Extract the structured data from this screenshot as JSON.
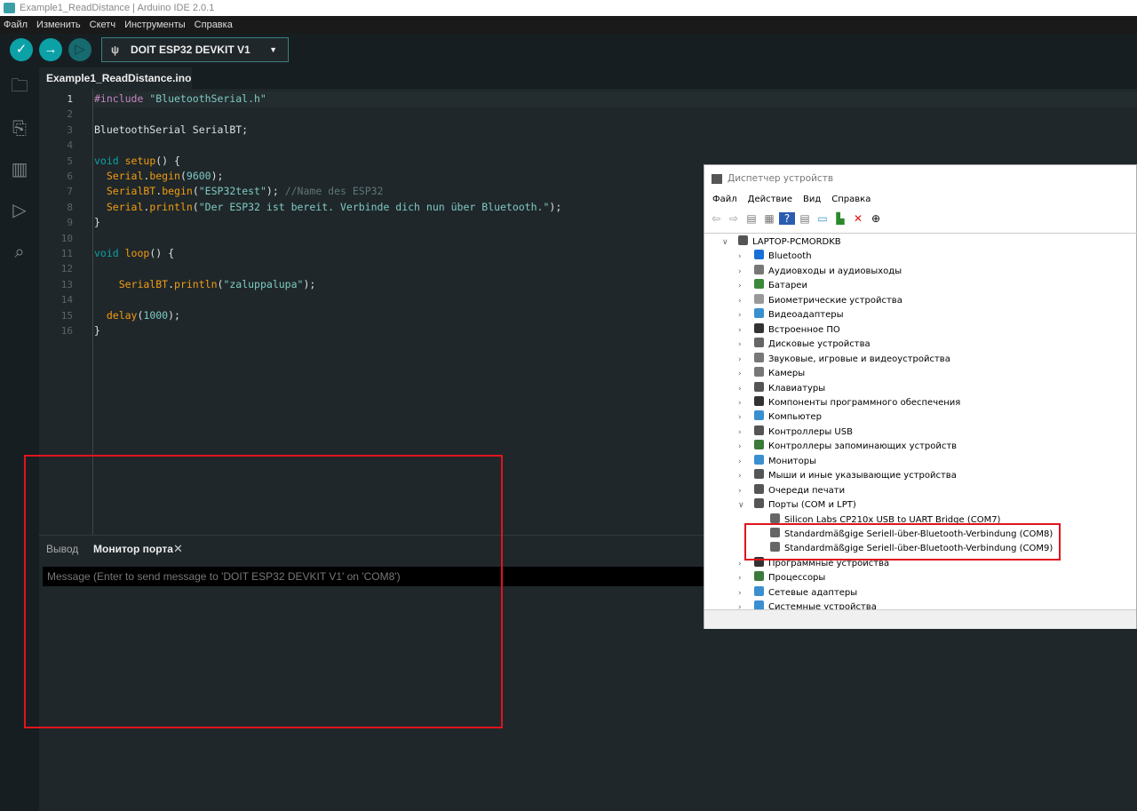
{
  "window": {
    "title": "Example1_ReadDistance | Arduino IDE 2.0.1"
  },
  "menu": [
    "Файл",
    "Изменить",
    "Скетч",
    "Инструменты",
    "Справка"
  ],
  "toolbar": {
    "verify_icon": "check-icon",
    "upload_icon": "arrow-right-icon",
    "debug_icon": "debug-icon",
    "board": "DOIT ESP32 DEVKIT V1"
  },
  "colors": {
    "accent": "#0ca1a6",
    "highlight_box": "#e0141e"
  },
  "editor": {
    "tab": "Example1_ReadDistance.ino",
    "lines": [
      [
        {
          "t": "#include ",
          "c": "k"
        },
        {
          "t": "\"BluetoothSerial.h\"",
          "c": "s"
        }
      ],
      [],
      [
        {
          "t": "BluetoothSerial SerialBT;",
          "c": "p"
        }
      ],
      [],
      [
        {
          "t": "void ",
          "c": "v"
        },
        {
          "t": "setup",
          "c": "f"
        },
        {
          "t": "() {",
          "c": "p"
        }
      ],
      [
        {
          "t": "  Serial",
          "c": "f"
        },
        {
          "t": ".",
          "c": "p"
        },
        {
          "t": "begin",
          "c": "f"
        },
        {
          "t": "(",
          "c": "p"
        },
        {
          "t": "9600",
          "c": "n"
        },
        {
          "t": ");",
          "c": "p"
        }
      ],
      [
        {
          "t": "  SerialBT",
          "c": "f"
        },
        {
          "t": ".",
          "c": "p"
        },
        {
          "t": "begin",
          "c": "f"
        },
        {
          "t": "(",
          "c": "p"
        },
        {
          "t": "\"ESP32test\"",
          "c": "s"
        },
        {
          "t": "); ",
          "c": "p"
        },
        {
          "t": "//Name des ESP32",
          "c": "c"
        }
      ],
      [
        {
          "t": "  Serial",
          "c": "f"
        },
        {
          "t": ".",
          "c": "p"
        },
        {
          "t": "println",
          "c": "f"
        },
        {
          "t": "(",
          "c": "p"
        },
        {
          "t": "\"Der ESP32 ist bereit. Verbinde dich nun über Bluetooth.\"",
          "c": "s"
        },
        {
          "t": ");",
          "c": "p"
        }
      ],
      [
        {
          "t": "}",
          "c": "p"
        }
      ],
      [],
      [
        {
          "t": "void ",
          "c": "v"
        },
        {
          "t": "loop",
          "c": "f"
        },
        {
          "t": "() {",
          "c": "p"
        }
      ],
      [],
      [
        {
          "t": "    SerialBT",
          "c": "f"
        },
        {
          "t": ".",
          "c": "p"
        },
        {
          "t": "println",
          "c": "f"
        },
        {
          "t": "(",
          "c": "p"
        },
        {
          "t": "\"zaluppalupa\"",
          "c": "s"
        },
        {
          "t": ");",
          "c": "p"
        }
      ],
      [],
      [
        {
          "t": "  delay",
          "c": "f"
        },
        {
          "t": "(",
          "c": "p"
        },
        {
          "t": "1000",
          "c": "n"
        },
        {
          "t": ");",
          "c": "p"
        }
      ],
      [
        {
          "t": "}",
          "c": "p"
        }
      ]
    ]
  },
  "bottom": {
    "tab_output": "Вывод",
    "tab_monitor": "Монитор порта",
    "message_placeholder": "Message (Enter to send message to 'DOIT ESP32 DEVKIT V1' on 'COM8')"
  },
  "device_manager": {
    "title": "Диспетчер устройств",
    "menu": [
      "Файл",
      "Действие",
      "Вид",
      "Справка"
    ],
    "tree": [
      {
        "label": "LAPTOP-PCMORDKB",
        "level": 0,
        "expanded": true
      },
      {
        "label": "Bluetooth",
        "level": 1
      },
      {
        "label": "Аудиовходы и аудиовыходы",
        "level": 1
      },
      {
        "label": "Батареи",
        "level": 1
      },
      {
        "label": "Биометрические устройства",
        "level": 1
      },
      {
        "label": "Видеоадаптеры",
        "level": 1
      },
      {
        "label": "Встроенное ПО",
        "level": 1
      },
      {
        "label": "Дисковые устройства",
        "level": 1
      },
      {
        "label": "Звуковые, игровые и видеоустройства",
        "level": 1
      },
      {
        "label": "Камеры",
        "level": 1
      },
      {
        "label": "Клавиатуры",
        "level": 1
      },
      {
        "label": "Компоненты программного обеспечения",
        "level": 1
      },
      {
        "label": "Компьютер",
        "level": 1
      },
      {
        "label": "Контроллеры USB",
        "level": 1
      },
      {
        "label": "Контроллеры запоминающих устройств",
        "level": 1
      },
      {
        "label": "Мониторы",
        "level": 1
      },
      {
        "label": "Мыши и иные указывающие устройства",
        "level": 1
      },
      {
        "label": "Очереди печати",
        "level": 1
      },
      {
        "label": "Порты (COM и LPT)",
        "level": 1,
        "expanded": true
      },
      {
        "label": "Silicon Labs CP210x USB to UART Bridge (COM7)",
        "level": 2
      },
      {
        "label": "Standardmäßgige Seriell-über-Bluetooth-Verbindung (COM8)",
        "level": 2
      },
      {
        "label": "Standardmäßgige Seriell-über-Bluetooth-Verbindung (COM9)",
        "level": 2
      },
      {
        "label": "Программные устройства",
        "level": 1
      },
      {
        "label": "Процессоры",
        "level": 1
      },
      {
        "label": "Сетевые адаптеры",
        "level": 1
      },
      {
        "label": "Системные устройства",
        "level": 1
      }
    ]
  }
}
